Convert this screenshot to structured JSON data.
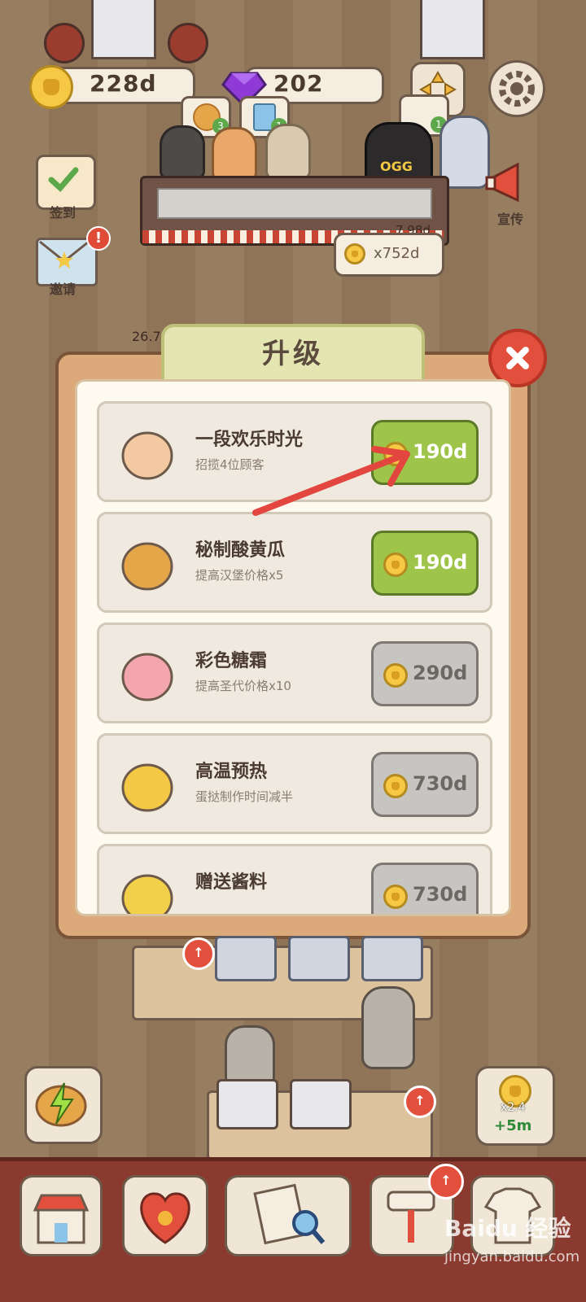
{
  "hud": {
    "coins": "228d",
    "gems": "202",
    "coin_color": "#f7c844",
    "gem_color": "#8f3ad6"
  },
  "side": {
    "checkin_label": "签到",
    "invite_label": "邀请",
    "invite_badge": "!",
    "promote_label": "宣传"
  },
  "scene": {
    "order_badge_1": "3",
    "order_badge_2": "1",
    "order_badge_3": "1",
    "tip_bubble": "x752d",
    "counter_value_1": "7.98d",
    "counter_value_2": "26.7",
    "shirt_text": "OGG"
  },
  "modal": {
    "title": "升级",
    "close_icon": "close-icon",
    "items": [
      {
        "name": "一段欢乐时光",
        "desc": "招揽4位顾客",
        "price": "190d",
        "enabled": true,
        "icon": "cat-icon"
      },
      {
        "name": "秘制酸黄瓜",
        "desc": "提高汉堡价格x5",
        "price": "190d",
        "enabled": true,
        "icon": "burger-icon"
      },
      {
        "name": "彩色糖霜",
        "desc": "提高圣代价格x10",
        "price": "290d",
        "enabled": false,
        "icon": "sundae-icon"
      },
      {
        "name": "高温预热",
        "desc": "蛋挞制作时间减半",
        "price": "730d",
        "enabled": false,
        "icon": "egg-tart-icon"
      },
      {
        "name": "赠送酱料",
        "desc": "",
        "price": "730d",
        "enabled": false,
        "icon": "fries-icon"
      }
    ]
  },
  "boost": {
    "multiplier": "x2.4",
    "duration": "+5m"
  },
  "watermark": {
    "brand": "Baidu 经验",
    "url": "jingyan.baidu.com"
  },
  "colors": {
    "enabled_button": "#9fc44a",
    "disabled_button": "#c7c5c1",
    "annotation_arrow": "#e2463e",
    "bottom_bar": "#8a3a2e"
  }
}
